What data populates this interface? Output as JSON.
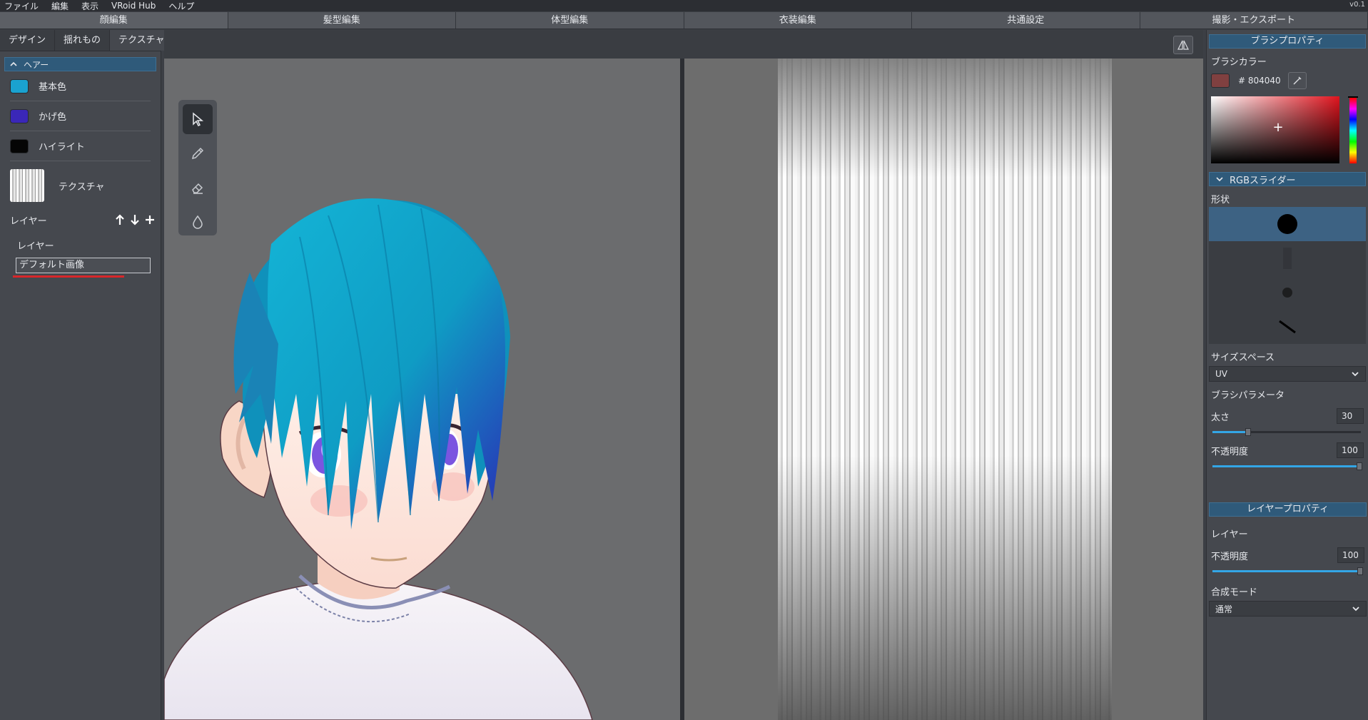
{
  "menu": {
    "items": [
      "ファイル",
      "編集",
      "表示",
      "VRoid Hub",
      "ヘルプ"
    ],
    "version": "v0.1"
  },
  "mode_tabs": [
    "顔編集",
    "髪型編集",
    "体型編集",
    "衣装編集",
    "共通設定",
    "撮影・エクスポート"
  ],
  "left": {
    "subtabs": [
      "デザイン",
      "揺れもの",
      "テクスチャ"
    ],
    "section_title": "ヘアー",
    "colors": [
      {
        "label": "基本色",
        "color": "#1aa2d0"
      },
      {
        "label": "かげ色",
        "color": "#3a27b8"
      },
      {
        "label": "ハイライト",
        "color": "#050505"
      }
    ],
    "texture_label": "テクスチャ",
    "layer_header": "レイヤー",
    "layer_group": "レイヤー",
    "layer_item": "デフォルト画像"
  },
  "tools": [
    "select-tool",
    "pen-tool",
    "eraser-tool",
    "fill-tool"
  ],
  "right": {
    "brush_header": "ブラシプロパティ",
    "brush_color_label": "ブラシカラー",
    "brush_color_hex": "# 804040",
    "brush_color": "#804040",
    "rgb_slider_label": "RGBスライダー",
    "shape_label": "形状",
    "size_space_label": "サイズスペース",
    "size_space_value": "UV",
    "brush_param_label": "ブラシパラメータ",
    "thickness_label": "太さ",
    "thickness_value": "30",
    "thickness_fraction": 0.22,
    "opacity_label": "不透明度",
    "opacity_value": "100",
    "layer_header": "レイヤープロパティ",
    "layer_label": "レイヤー",
    "layer_opacity_label": "不透明度",
    "layer_opacity_value": "100",
    "blend_label": "合成モード",
    "blend_value": "通常"
  },
  "accent": "#33a6e6",
  "header_blue": "#2f5a7a"
}
